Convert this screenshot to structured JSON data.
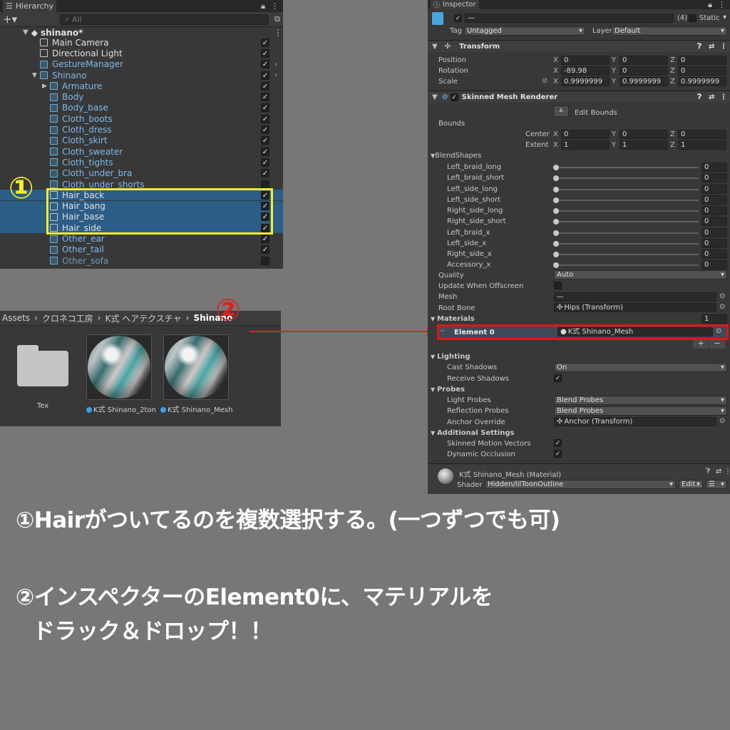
{
  "hierarchy": {
    "tab": "Hierarchy",
    "search_placeholder": "All",
    "scene": "shinano*",
    "rows": [
      {
        "label": "Main Camera",
        "color": "white",
        "indent": 1,
        "checked": true
      },
      {
        "label": "Directional Light",
        "color": "white",
        "indent": 1,
        "checked": true
      },
      {
        "label": "GestureManager",
        "color": "blue",
        "indent": 1,
        "checked": true
      },
      {
        "label": "Shinano",
        "color": "blue",
        "indent": 1,
        "checked": true
      },
      {
        "label": "Armature",
        "color": "blue",
        "indent": 2,
        "checked": true
      },
      {
        "label": "Body",
        "color": "blue",
        "indent": 2,
        "checked": true
      },
      {
        "label": "Body_base",
        "color": "blue",
        "indent": 2,
        "checked": true
      },
      {
        "label": "Cloth_boots",
        "color": "blue",
        "indent": 2,
        "checked": true
      },
      {
        "label": "Cloth_dress",
        "color": "blue",
        "indent": 2,
        "checked": true
      },
      {
        "label": "Cloth_skirt",
        "color": "blue",
        "indent": 2,
        "checked": true
      },
      {
        "label": "Cloth_sweater",
        "color": "blue",
        "indent": 2,
        "checked": true
      },
      {
        "label": "Cloth_tights",
        "color": "blue",
        "indent": 2,
        "checked": true
      },
      {
        "label": "Cloth_under_bra",
        "color": "blue",
        "indent": 2,
        "checked": true
      },
      {
        "label": "Cloth_under_shorts",
        "color": "blue",
        "indent": 2,
        "checked": false
      },
      {
        "label": "Hair_back",
        "color": "white",
        "indent": 2,
        "checked": true,
        "selected": true
      },
      {
        "label": "Hair_bang",
        "color": "white",
        "indent": 2,
        "checked": true,
        "selected": true
      },
      {
        "label": "Hair_base",
        "color": "white",
        "indent": 2,
        "checked": true,
        "selected": true
      },
      {
        "label": "Hair_side",
        "color": "white",
        "indent": 2,
        "checked": true,
        "selected": true
      },
      {
        "label": "Other_ear",
        "color": "blue",
        "indent": 2,
        "checked": true
      },
      {
        "label": "Other_tail",
        "color": "blue",
        "indent": 2,
        "checked": true
      },
      {
        "label": "Other_sofa",
        "color": "faded",
        "indent": 2,
        "checked": false
      }
    ]
  },
  "annotation1": "①",
  "annotation2": "②",
  "project": {
    "breadcrumb": [
      "Assets",
      "クロネコ工房",
      "K式 ヘアテクスチャ",
      "Shinano"
    ],
    "assets": [
      {
        "label": "Tex",
        "kind": "folder"
      },
      {
        "label": "K式 Shinano_2ton",
        "kind": "material"
      },
      {
        "label": "K式 Shinano_Mesh",
        "kind": "material"
      }
    ]
  },
  "inspector": {
    "tab": "Inspector",
    "name_value": "—",
    "count": "(4)",
    "static_label": "Static",
    "tag_label": "Tag",
    "tag_value": "Untagged",
    "layer_label": "Layer",
    "layer_value": "Default",
    "transform": {
      "title": "Transform",
      "position_label": "Position",
      "position": [
        "0",
        "0",
        "0"
      ],
      "rotation_label": "Rotation",
      "rotation": [
        "-89.98",
        "0",
        "0"
      ],
      "scale_label": "Scale",
      "scale": [
        "0.9999999",
        "0.9999999",
        "0.9999999"
      ]
    },
    "smr": {
      "title": "Skinned Mesh Renderer",
      "edit_bounds": "Edit Bounds",
      "bounds_label": "Bounds",
      "center_label": "Center",
      "center": [
        "0",
        "0",
        "0"
      ],
      "extent_label": "Extent",
      "extent": [
        "1",
        "1",
        "1"
      ],
      "blendshapes_label": "BlendShapes",
      "blendshapes": [
        {
          "name": "Left_braid_long",
          "value": "0"
        },
        {
          "name": "Left_braid_short",
          "value": "0"
        },
        {
          "name": "Left_side_long",
          "value": "0"
        },
        {
          "name": "Left_side_short",
          "value": "0"
        },
        {
          "name": "Right_side_long",
          "value": "0"
        },
        {
          "name": "Right_side_short",
          "value": "0"
        },
        {
          "name": "Left_braid_x",
          "value": "0"
        },
        {
          "name": "Left_side_x",
          "value": "0"
        },
        {
          "name": "Right_side_x",
          "value": "0"
        },
        {
          "name": "Accessory_x",
          "value": "0"
        }
      ],
      "quality_label": "Quality",
      "quality": "Auto",
      "update_offscreen_label": "Update When Offscreen",
      "mesh_label": "Mesh",
      "mesh": "—",
      "root_bone_label": "Root Bone",
      "root_bone": "Hips (Transform)",
      "materials_label": "Materials",
      "materials_count": "1",
      "element0_label": "Element 0",
      "element0": "K式 Shinano_Mesh",
      "lighting_label": "Lighting",
      "cast_shadows_label": "Cast Shadows",
      "cast_shadows": "On",
      "receive_shadows_label": "Receive Shadows",
      "probes_label": "Probes",
      "light_probes_label": "Light Probes",
      "light_probes": "Blend Probes",
      "reflection_probes_label": "Reflection Probes",
      "reflection_probes": "Blend Probes",
      "anchor_label": "Anchor Override",
      "anchor": "Anchor (Transform)",
      "additional_label": "Additional Settings",
      "motion_vectors_label": "Skinned Motion Vectors",
      "dynamic_occlusion_label": "Dynamic Occlusion"
    },
    "material": {
      "title": "K式 Shinano_Mesh (Material)",
      "shader_label": "Shader",
      "shader": "Hidden/lilToonOutline",
      "edit_label": "Edit..."
    }
  },
  "instructions": {
    "line1": "①Hairがついてるのを複数選択する。(一つずつでも可)",
    "line2": "②インスペクターのElement0に、マテリアルを",
    "line3": "ドラック＆ドロップ！！"
  }
}
